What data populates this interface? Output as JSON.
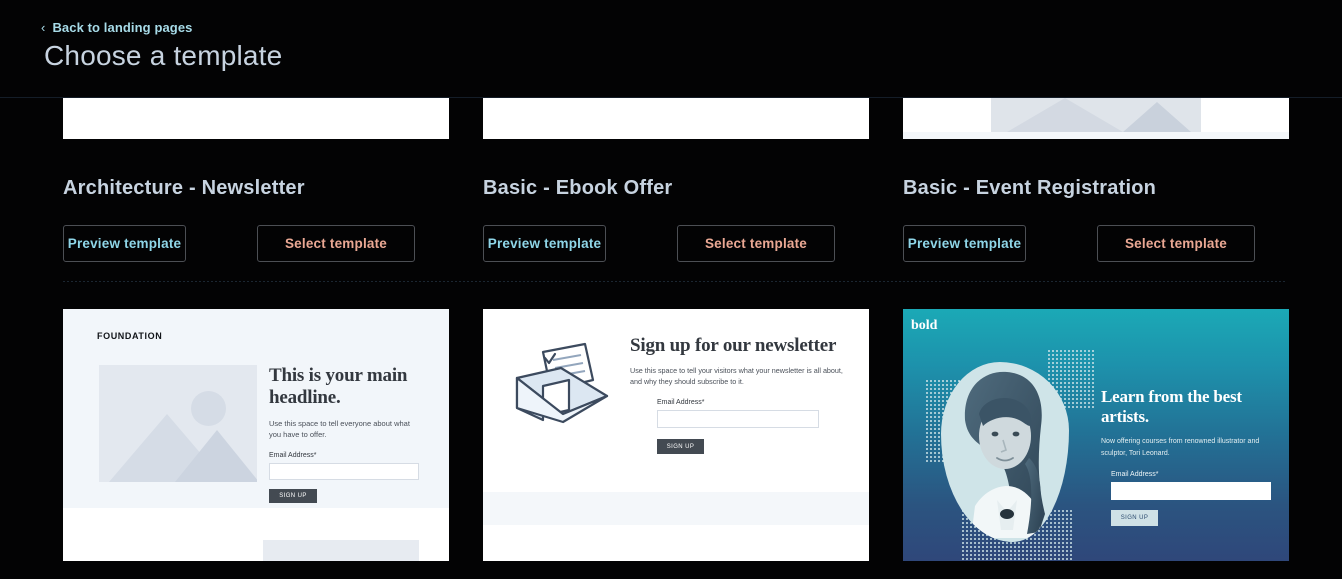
{
  "header": {
    "back_link": "Back to landing pages",
    "back_chevron": "chevron-left-icon",
    "chevron_glyph": "‹",
    "title": "Choose a template"
  },
  "colors": {
    "page_background": "#030304",
    "title_text": "#c7d3e0",
    "back_link_text": "#a7dbe8",
    "preview_button_text": "#8fd6e8",
    "select_button_text": "#eaa894",
    "button_border": "#4c4f54"
  },
  "buttons": {
    "preview": "Preview template",
    "select": "Select template"
  },
  "templates": [
    {
      "name": "Architecture - Newsletter"
    },
    {
      "name": "Basic - Ebook Offer"
    },
    {
      "name": "Basic - Event Registration"
    }
  ],
  "previews": {
    "foundation": {
      "logo": "FOUNDATION",
      "headline": "This is your main headline.",
      "body": "Use this space to tell everyone about what you have to offer.",
      "field_label": "Email Address*",
      "submit": "SIGN UP"
    },
    "newsletter": {
      "headline": "Sign up for our newsletter",
      "body": "Use this space to tell your visitors what your newsletter is all about, and why they should subscribe to it.",
      "field_label": "Email Address*",
      "submit": "SIGN UP"
    },
    "bold": {
      "logo": "bold",
      "headline": "Learn from the best artists.",
      "body": "Now offering courses from renowned illustrator and sculptor, Tori Leonard.",
      "field_label": "Email Address*",
      "submit": "SIGN UP"
    }
  }
}
